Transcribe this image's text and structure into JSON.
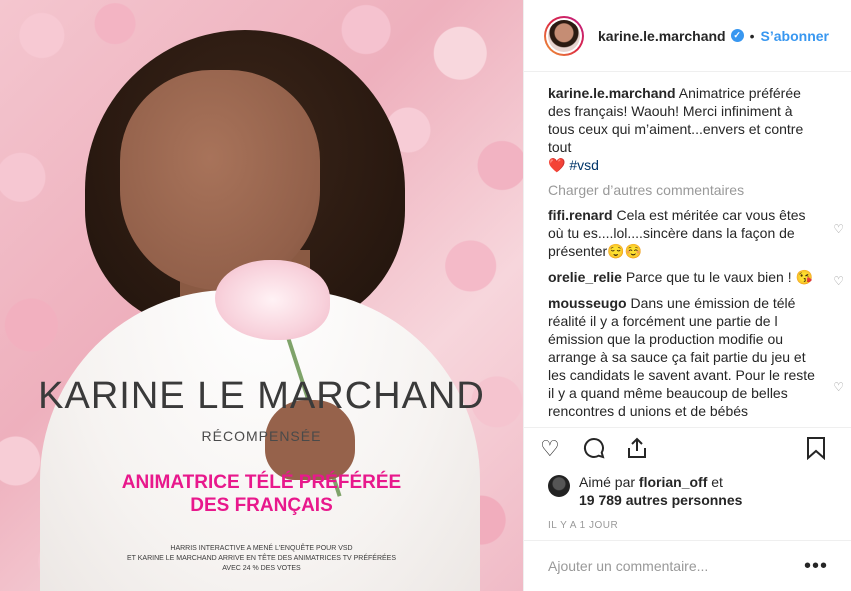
{
  "post_image": {
    "title": "KARINE LE MARCHAND",
    "subtitle": "RÉCOMPENSÉE",
    "headline_line1": "ANIMATRICE TÉLÉ PRÉFÉRÉE",
    "headline_line2": "DES FRANÇAIS",
    "footnote_line1": "HARRIS INTERACTIVE A MENÉ L'ENQUÊTE POUR VSD",
    "footnote_line2": "ET KARINE LE MARCHAND ARRIVE EN TÊTE DES ANIMATRICES TV PRÉFÉRÉES",
    "footnote_line3": "AVEC 24 % DES VOTES"
  },
  "header": {
    "username": "karine.le.marchand",
    "verified_icon": "verified-badge-icon",
    "separator": "•",
    "follow_label": "S’abonner"
  },
  "caption": {
    "username": "karine.le.marchand",
    "text": "Animatrice préférée des français! Waouh! Merci infiniment à tous ceux qui m’aiment...envers et contre tout",
    "emoji": "❤️",
    "hashtag": "#vsd"
  },
  "load_more_label": "Charger d’autres commentaires",
  "comments": [
    {
      "username": "fifi.renard",
      "text": "Cela est méritée car vous êtes où tu es....lol....sincère dans la façon de présenter😌☺️"
    },
    {
      "username": "orelie_relie",
      "text": "Parce que tu le vaux bien ! 😘"
    },
    {
      "username": "mousseugo",
      "text": "Dans une émission de télé réalité il y a forcément une partie de l émission que la production modifie ou arrange à sa sauce ça fait partie du jeu et les candidats le savent avant. Pour le reste il y a quand même beaucoup de belles rencontres d unions et de bébés"
    }
  ],
  "likes": {
    "prefix": "Aimé par",
    "user": "florian_off",
    "connector": "et",
    "others": "19 789 autres personnes"
  },
  "timestamp": "IL Y A 1 JOUR",
  "add_comment": {
    "placeholder": "Ajouter un commentaire...",
    "more_label": "•••"
  }
}
